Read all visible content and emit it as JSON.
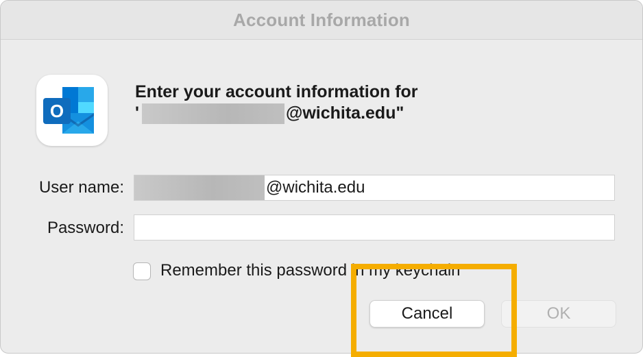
{
  "window": {
    "title": "Account Information"
  },
  "app_icon": {
    "name": "outlook-icon",
    "letter": "O",
    "brand_color": "#0f6cbd"
  },
  "heading": {
    "line1": "Enter your account information for",
    "line2_prefix": "'",
    "line2_suffix": "@wichita.edu\""
  },
  "form": {
    "username_label": "User name:",
    "username_value_suffix": "@wichita.edu",
    "password_label": "Password:",
    "password_value": "",
    "remember_label": "Remember this password in my keychain",
    "remember_checked": false
  },
  "buttons": {
    "cancel_label": "Cancel",
    "ok_label": "OK",
    "ok_enabled": false
  },
  "annotation": {
    "highlight_color": "#f5ad00",
    "target": "cancel-button"
  }
}
